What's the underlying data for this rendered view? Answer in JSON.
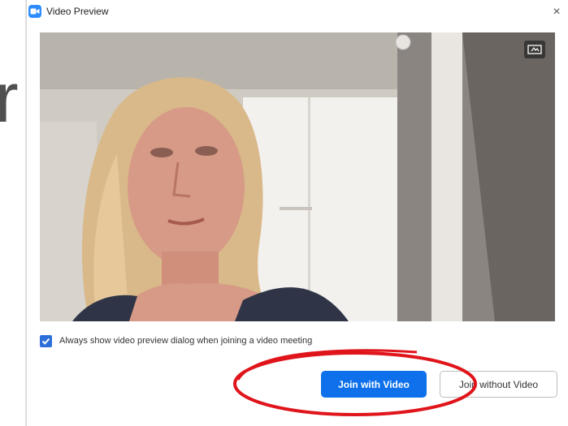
{
  "background": {
    "partial_text": "r"
  },
  "window": {
    "title": "Video Preview",
    "close_glyph": "×",
    "icon": "zoom-camera-icon"
  },
  "video_preview": {
    "description_icon": "self-view-toggle-icon"
  },
  "options": {
    "always_show_preview_label": "Always show video preview dialog when joining a video meeting",
    "always_show_preview_checked": true
  },
  "actions": {
    "join_with_video": "Join with Video",
    "join_without_video": "Join without Video"
  },
  "colors": {
    "accent": "#0e71eb",
    "checkbox": "#2d6fd9",
    "annotation": "#e0141b"
  }
}
